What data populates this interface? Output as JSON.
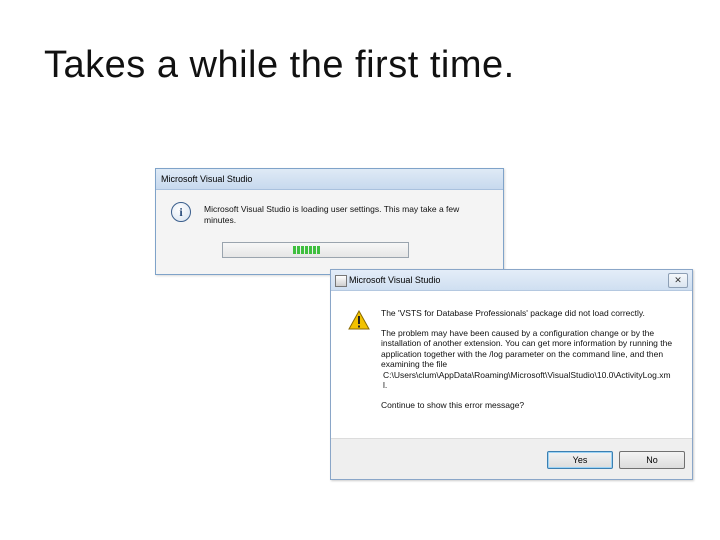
{
  "slide": {
    "title": "Takes a while the first time."
  },
  "loading_dialog": {
    "title": "Microsoft Visual Studio",
    "message": "Microsoft Visual Studio is loading user settings. This may take a few minutes.",
    "icon": "info-icon",
    "progress_segments": 7
  },
  "error_dialog": {
    "title": "Microsoft Visual Studio",
    "close_label": "✕",
    "icon": "warning-icon",
    "line1": "The 'VSTS for Database Professionals' package did not load correctly.",
    "line2": "The problem may have been caused by a configuration change or by the installation of another extension. You can get more information by running the application together with the /log parameter on the command line, and then examining the file",
    "line3": "C:\\Users\\clum\\AppData\\Roaming\\Microsoft\\VisualStudio\\10.0\\ActivityLog.xml.",
    "line4": "Continue to show this error message?",
    "yes_label": "Yes",
    "no_label": "No"
  },
  "colors": {
    "progress": "#3fbf3f",
    "titlebar": "#c7d9ee",
    "warning": "#f2c200"
  }
}
